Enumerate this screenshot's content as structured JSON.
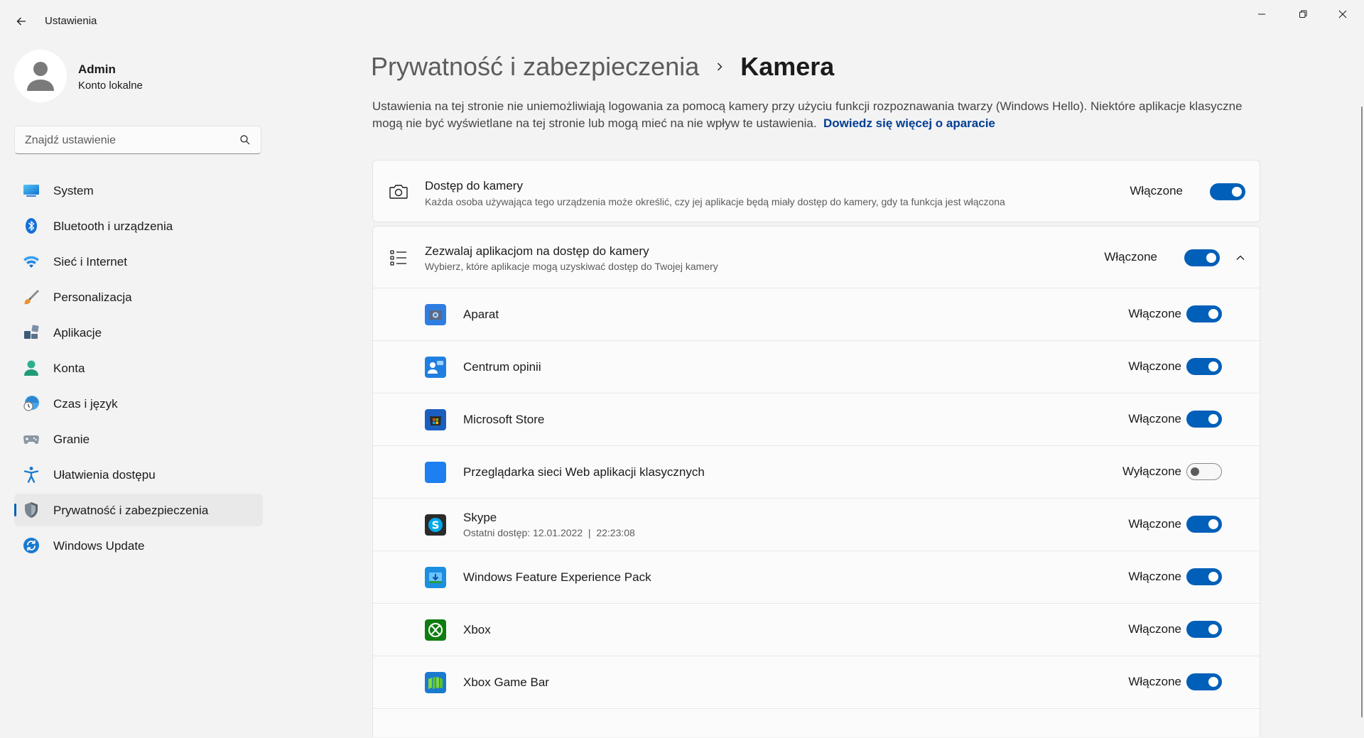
{
  "window": {
    "title": "Ustawienia"
  },
  "profile": {
    "name": "Admin",
    "account": "Konto lokalne"
  },
  "search": {
    "placeholder": "Znajdź ustawienie"
  },
  "sidebar": {
    "items": [
      {
        "label": "System",
        "icon": "monitor-icon"
      },
      {
        "label": "Bluetooth i urządzenia",
        "icon": "bluetooth-icon"
      },
      {
        "label": "Sieć i Internet",
        "icon": "wifi-icon"
      },
      {
        "label": "Personalizacja",
        "icon": "brush-icon"
      },
      {
        "label": "Aplikacje",
        "icon": "apps-icon"
      },
      {
        "label": "Konta",
        "icon": "person-icon"
      },
      {
        "label": "Czas i język",
        "icon": "clock-globe-icon"
      },
      {
        "label": "Granie",
        "icon": "gamepad-icon"
      },
      {
        "label": "Ułatwienia dostępu",
        "icon": "accessibility-icon"
      },
      {
        "label": "Prywatność i zabezpieczenia",
        "icon": "shield-icon",
        "active": true
      },
      {
        "label": "Windows Update",
        "icon": "update-icon"
      }
    ]
  },
  "breadcrumb": {
    "parent": "Prywatność i zabezpieczenia",
    "current": "Kamera"
  },
  "description": {
    "text": "Ustawienia na tej stronie nie uniemożliwiają logowania za pomocą kamery przy użyciu funkcji rozpoznawania twarzy (Windows Hello). Niektóre aplikacje klasyczne mogą nie być wyświetlane na tej stronie lub mogą mieć na nie wpływ te ustawienia.",
    "link": "Dowiedz się więcej o aparacie"
  },
  "camera_access": {
    "title": "Dostęp do kamery",
    "subtitle": "Każda osoba używająca tego urządzenia może określić, czy jej aplikacje będą miały dostęp do kamery, gdy ta funkcja jest włączona",
    "state": "Włączone",
    "on": true
  },
  "app_access": {
    "title": "Zezwalaj aplikacjom na dostęp do kamery",
    "subtitle": "Wybierz, które aplikacje mogą uzyskiwać dostęp do Twojej kamery",
    "state": "Włączone",
    "on": true
  },
  "apps": [
    {
      "name": "Aparat",
      "state": "Włączone",
      "on": true,
      "icon": "camera-app-icon",
      "color": "#2f7de1"
    },
    {
      "name": "Centrum opinii",
      "state": "Włączone",
      "on": true,
      "icon": "feedback-hub-icon",
      "color": "#1f7fe0"
    },
    {
      "name": "Microsoft Store",
      "state": "Włączone",
      "on": true,
      "icon": "store-icon",
      "color": "#1a5fc0"
    },
    {
      "name": "Przeglądarka sieci Web aplikacji klasycznych",
      "state": "Wyłączone",
      "on": false,
      "icon": "web-viewer-icon",
      "color": "#1e7ff0"
    },
    {
      "name": "Skype",
      "subtitle": "Ostatni dostęp: 12.01.2022  |  22:23:08",
      "state": "Włączone",
      "on": true,
      "icon": "skype-icon",
      "color": "#2b2b2b"
    },
    {
      "name": "Windows Feature Experience Pack",
      "state": "Włączone",
      "on": true,
      "icon": "feature-pack-icon",
      "color": "#1c8fe0"
    },
    {
      "name": "Xbox",
      "state": "Włączone",
      "on": true,
      "icon": "xbox-icon",
      "color": "#107c10"
    },
    {
      "name": "Xbox Game Bar",
      "state": "Włączone",
      "on": true,
      "icon": "game-bar-icon",
      "color": "#1a7ad0"
    }
  ]
}
